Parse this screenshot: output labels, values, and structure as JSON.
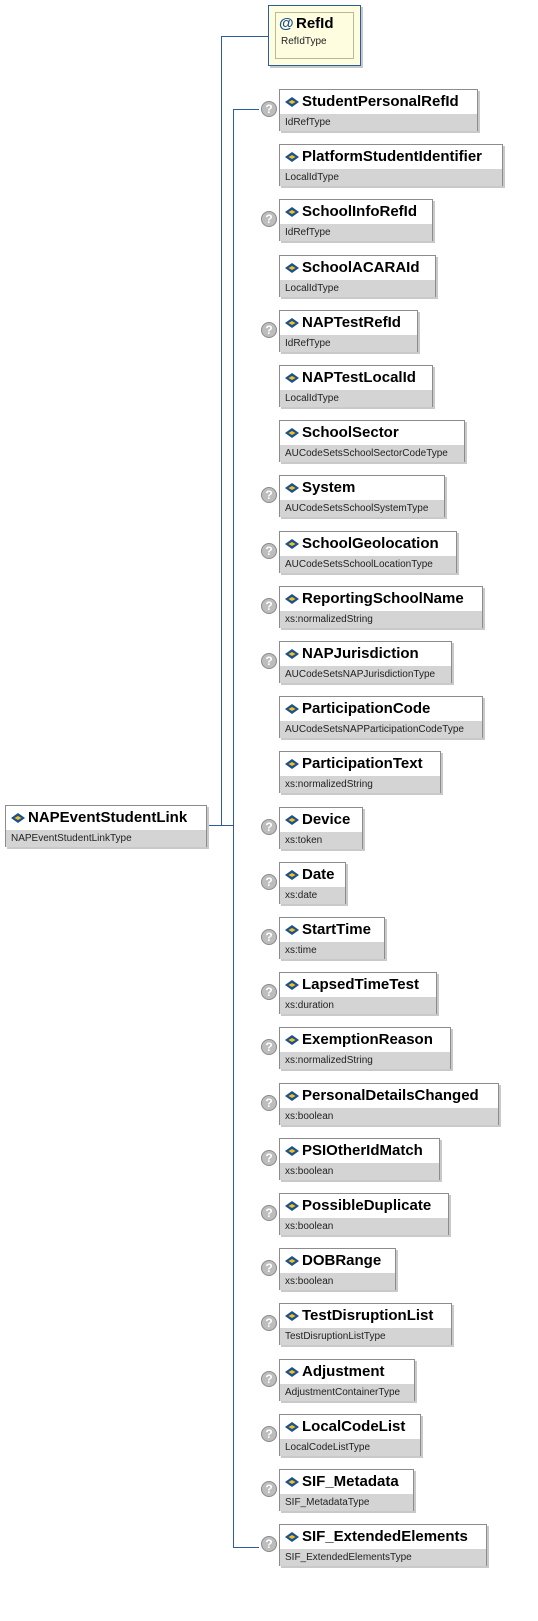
{
  "root": {
    "name": "NAPEventStudentLink",
    "type": "NAPEventStudentLinkType"
  },
  "attribute": {
    "name": "RefId",
    "type": "RefIdType"
  },
  "elements": [
    {
      "name": "StudentPersonalRefId",
      "type": "IdRefType",
      "optional": true
    },
    {
      "name": "PlatformStudentIdentifier",
      "type": "LocalIdType",
      "optional": false
    },
    {
      "name": "SchoolInfoRefId",
      "type": "IdRefType",
      "optional": true
    },
    {
      "name": "SchoolACARAId",
      "type": "LocalIdType",
      "optional": false
    },
    {
      "name": "NAPTestRefId",
      "type": "IdRefType",
      "optional": true
    },
    {
      "name": "NAPTestLocalId",
      "type": "LocalIdType",
      "optional": false
    },
    {
      "name": "SchoolSector",
      "type": "AUCodeSetsSchoolSectorCodeType",
      "optional": false
    },
    {
      "name": "System",
      "type": "AUCodeSetsSchoolSystemType",
      "optional": true
    },
    {
      "name": "SchoolGeolocation",
      "type": "AUCodeSetsSchoolLocationType",
      "optional": true
    },
    {
      "name": "ReportingSchoolName",
      "type": "xs:normalizedString",
      "optional": true
    },
    {
      "name": "NAPJurisdiction",
      "type": "AUCodeSetsNAPJurisdictionType",
      "optional": true
    },
    {
      "name": "ParticipationCode",
      "type": "AUCodeSetsNAPParticipationCodeType",
      "optional": false
    },
    {
      "name": "ParticipationText",
      "type": "xs:normalizedString",
      "optional": false
    },
    {
      "name": "Device",
      "type": "xs:token",
      "optional": true
    },
    {
      "name": "Date",
      "type": "xs:date",
      "optional": true
    },
    {
      "name": "StartTime",
      "type": "xs:time",
      "optional": true
    },
    {
      "name": "LapsedTimeTest",
      "type": "xs:duration",
      "optional": true
    },
    {
      "name": "ExemptionReason",
      "type": "xs:normalizedString",
      "optional": true
    },
    {
      "name": "PersonalDetailsChanged",
      "type": "xs:boolean",
      "optional": true
    },
    {
      "name": "PSIOtherIdMatch",
      "type": "xs:boolean",
      "optional": true
    },
    {
      "name": "PossibleDuplicate",
      "type": "xs:boolean",
      "optional": true
    },
    {
      "name": "DOBRange",
      "type": "xs:boolean",
      "optional": true
    },
    {
      "name": "TestDisruptionList",
      "type": "TestDisruptionListType",
      "optional": true
    },
    {
      "name": "Adjustment",
      "type": "AdjustmentContainerType",
      "optional": true
    },
    {
      "name": "LocalCodeList",
      "type": "LocalCodeListType",
      "optional": true
    },
    {
      "name": "SIF_Metadata",
      "type": "SIF_MetadataType",
      "optional": true
    },
    {
      "name": "SIF_ExtendedElements",
      "type": "SIF_ExtendedElementsType",
      "optional": true
    }
  ],
  "optional_marker": "?",
  "attribute_marker": "@",
  "colors": {
    "connector": "#2a5d9a",
    "type_band": "#d4d4d4",
    "attribute_fill": "#fefde0",
    "icon_blue": "#1c4f8f",
    "icon_yellow": "#f2c21b"
  }
}
